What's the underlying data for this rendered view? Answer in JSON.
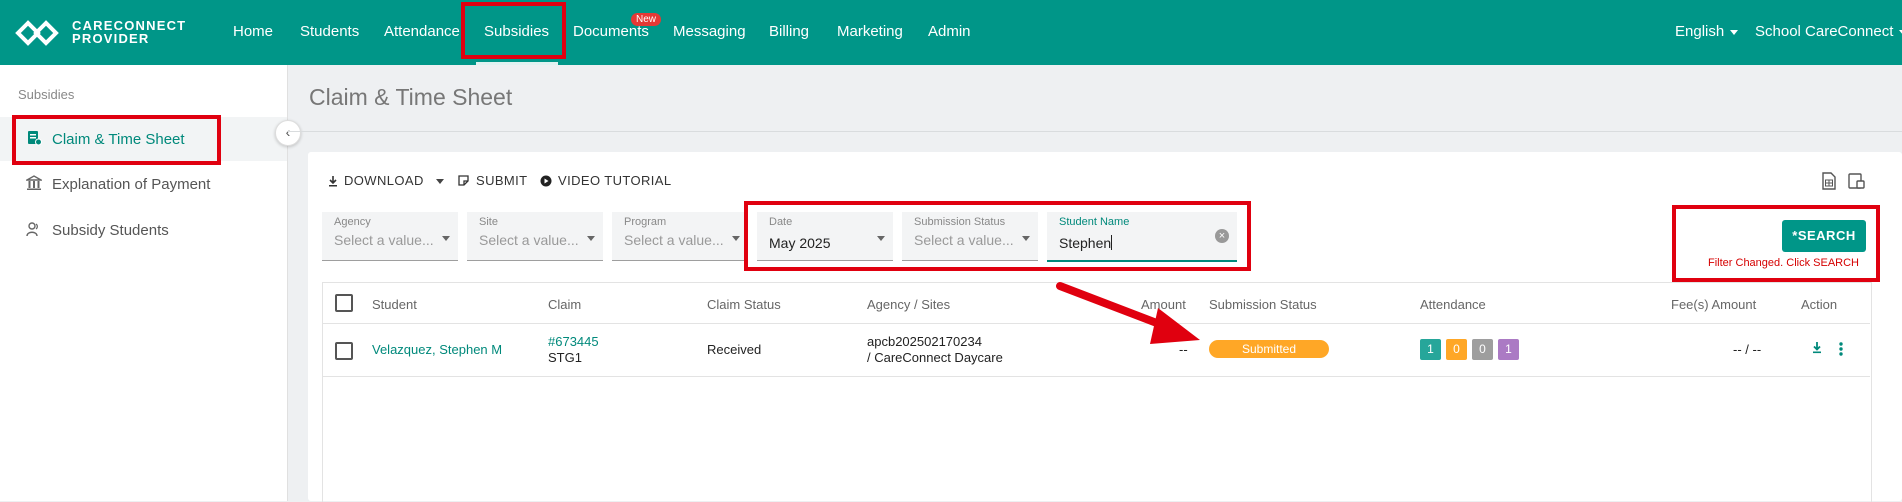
{
  "app": {
    "logo_line1": "CARECONNECT",
    "logo_line2": "PROVIDER",
    "brand_color": "#009688",
    "accent_color": "#00897b"
  },
  "nav": {
    "items": [
      {
        "label": "Home"
      },
      {
        "label": "Students"
      },
      {
        "label": "Attendance"
      },
      {
        "label": "Subsidies"
      },
      {
        "label": "Documents"
      },
      {
        "label": "Messaging"
      },
      {
        "label": "Billing"
      },
      {
        "label": "Marketing"
      },
      {
        "label": "Admin"
      }
    ],
    "new_badge": "New",
    "language": "English",
    "school": "School CareConnect"
  },
  "sidebar": {
    "heading": "Subsidies",
    "items": [
      {
        "label": "Claim & Time Sheet",
        "icon": "claim-sheet-icon"
      },
      {
        "label": "Explanation of Payment",
        "icon": "bank-icon"
      },
      {
        "label": "Subsidy Students",
        "icon": "users-icon"
      }
    ]
  },
  "page": {
    "title": "Claim & Time Sheet"
  },
  "toolbar": {
    "download": "DOWNLOAD",
    "submit": "SUBMIT",
    "video_tutorial": "VIDEO TUTORIAL"
  },
  "filters": {
    "agency": {
      "label": "Agency",
      "placeholder": "Select a value..."
    },
    "site": {
      "label": "Site",
      "placeholder": "Select a value..."
    },
    "program": {
      "label": "Program",
      "placeholder": "Select a value..."
    },
    "date": {
      "label": "Date",
      "value": "May 2025"
    },
    "submission_status": {
      "label": "Submission Status",
      "placeholder": "Select a value..."
    },
    "student_name": {
      "label": "Student Name",
      "value": "Stephen"
    }
  },
  "search": {
    "label": "*SEARCH",
    "note": "Filter Changed.  Click SEARCH"
  },
  "table": {
    "headers": {
      "student": "Student",
      "claim": "Claim",
      "claim_status": "Claim Status",
      "agency_sites": "Agency / Sites",
      "amount": "Amount",
      "submission_status": "Submission Status",
      "attendance": "Attendance",
      "fees_amount": "Fee(s) Amount",
      "action": "Action"
    },
    "rows": [
      {
        "student": "Velazquez, Stephen M",
        "claim_number": "#673445",
        "claim_code": "STG1",
        "claim_status": "Received",
        "agency": "apcb202502170234",
        "sites": "/ CareConnect Daycare",
        "amount": "--",
        "submission_status": "Submitted",
        "attendance": [
          {
            "value": "1",
            "color": "#26a69a"
          },
          {
            "value": "0",
            "color": "#ffa726"
          },
          {
            "value": "0",
            "color": "#9e9e9e"
          },
          {
            "value": "1",
            "color": "#ab7ac4"
          }
        ],
        "fees_amount": "-- / --"
      }
    ]
  }
}
